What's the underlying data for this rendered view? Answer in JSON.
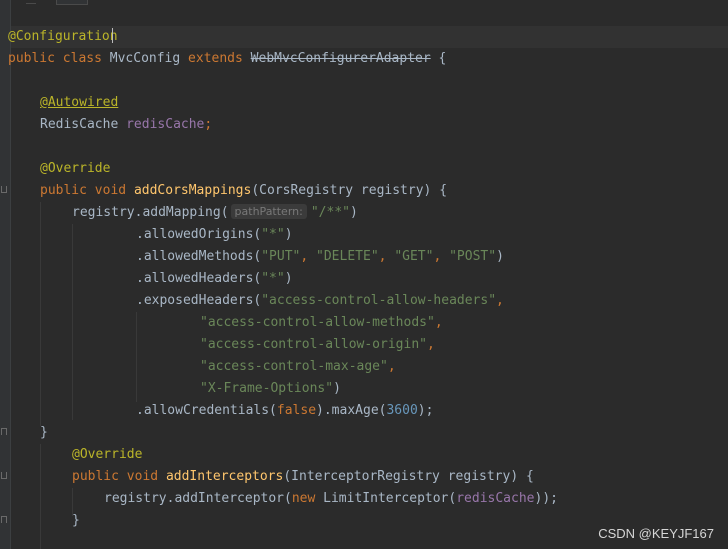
{
  "editor": {
    "language": "Java",
    "theme_colors": {
      "background": "#2b2b2b",
      "keyword": "#cc7832",
      "annotation": "#bbb529",
      "method": "#ffc66d",
      "string": "#6a8759",
      "number": "#6897bb",
      "field": "#9876aa",
      "default": "#a9b7c6"
    },
    "lines": {
      "l1": {
        "annotation": "@Configuration"
      },
      "l2": {
        "kw_public": "public",
        "kw_class": "class",
        "class_name": "MvcConfig",
        "kw_extends": "extends",
        "superclass": "WebMvcConfigurerAdapter",
        "brace": "{"
      },
      "l4": {
        "annotation": "@Autowired"
      },
      "l5": {
        "type": "RedisCache",
        "field": "redisCache",
        "semi": ";"
      },
      "l7": {
        "annotation": "@Override"
      },
      "l8": {
        "kw_public": "public",
        "kw_void": "void",
        "method": "addCorsMappings",
        "open": "(",
        "param_type": "CorsRegistry",
        "param": "registry",
        "close": ")",
        "brace": "{"
      },
      "l9": {
        "prefix": "registry.addMapping(",
        "hint": "pathPattern:",
        "arg": "\"/**\"",
        "suffix": ")"
      },
      "l10": {
        "prefix": ".allowedOrigins(",
        "arg1": "\"*\"",
        "suffix": ")"
      },
      "l11": {
        "prefix": ".allowedMethods(",
        "arg1": "\"PUT\"",
        "arg2": "\"DELETE\"",
        "arg3": "\"GET\"",
        "arg4": "\"POST\"",
        "suffix": ")"
      },
      "l12": {
        "prefix": ".allowedHeaders(",
        "arg1": "\"*\"",
        "suffix": ")"
      },
      "l13": {
        "prefix": ".exposedHeaders(",
        "arg1": "\"access-control-allow-headers\"",
        "suffix": ","
      },
      "l14": {
        "arg": "\"access-control-allow-methods\"",
        "suffix": ","
      },
      "l15": {
        "arg": "\"access-control-allow-origin\"",
        "suffix": ","
      },
      "l16": {
        "arg": "\"access-control-max-age\"",
        "suffix": ","
      },
      "l17": {
        "arg": "\"X-Frame-Options\"",
        "suffix": ")"
      },
      "l18": {
        "prefix": ".allowCredentials(",
        "kw_false": "false",
        "mid": ").maxAge(",
        "number": "3600",
        "suffix": ");"
      },
      "l19": {
        "brace": "}"
      },
      "l20": {
        "annotation": "@Override"
      },
      "l21": {
        "kw_public": "public",
        "kw_void": "void",
        "method": "addInterceptors",
        "open": "(",
        "param_type": "InterceptorRegistry",
        "param": "registry",
        "close": ")",
        "brace": "{"
      },
      "l22": {
        "prefix": "registry.addInterceptor(",
        "kw_new": "new",
        "ctor": "LimitInterceptor(",
        "field": "redisCache",
        "suffix": "));"
      },
      "l23": {
        "brace": "}"
      }
    }
  },
  "watermark": "CSDN @KEYJF167"
}
